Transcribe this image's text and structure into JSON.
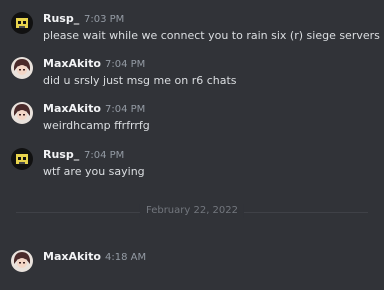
{
  "messages": [
    {
      "author": "Rusp_",
      "time": "7:03 PM",
      "text": "please wait while we connect you to rain six (r) siege servers",
      "avatar_icon": "rusp-avatar-icon"
    },
    {
      "author": "MaxAkito",
      "time": "7:04 PM",
      "text": "did u srsly just msg me on r6 chats",
      "avatar_icon": "maxakito-avatar-icon"
    },
    {
      "author": "MaxAkito",
      "time": "7:04 PM",
      "text": "weirdhcamp ffrfrrfg",
      "avatar_icon": "maxakito-avatar-icon"
    },
    {
      "author": "Rusp_",
      "time": "7:04 PM",
      "text": "wtf are you saying",
      "avatar_icon": "rusp-avatar-icon"
    },
    {
      "author": "MaxAkito",
      "time": "4:18 AM",
      "text": "",
      "avatar_icon": "maxakito-avatar-icon"
    }
  ],
  "date_divider": {
    "label": "February 22, 2022"
  },
  "colors": {
    "background": "#313338",
    "author": "#f2f3f5",
    "text": "#dbdee1",
    "timestamp": "#949ba4",
    "divider": "#3f4147"
  }
}
